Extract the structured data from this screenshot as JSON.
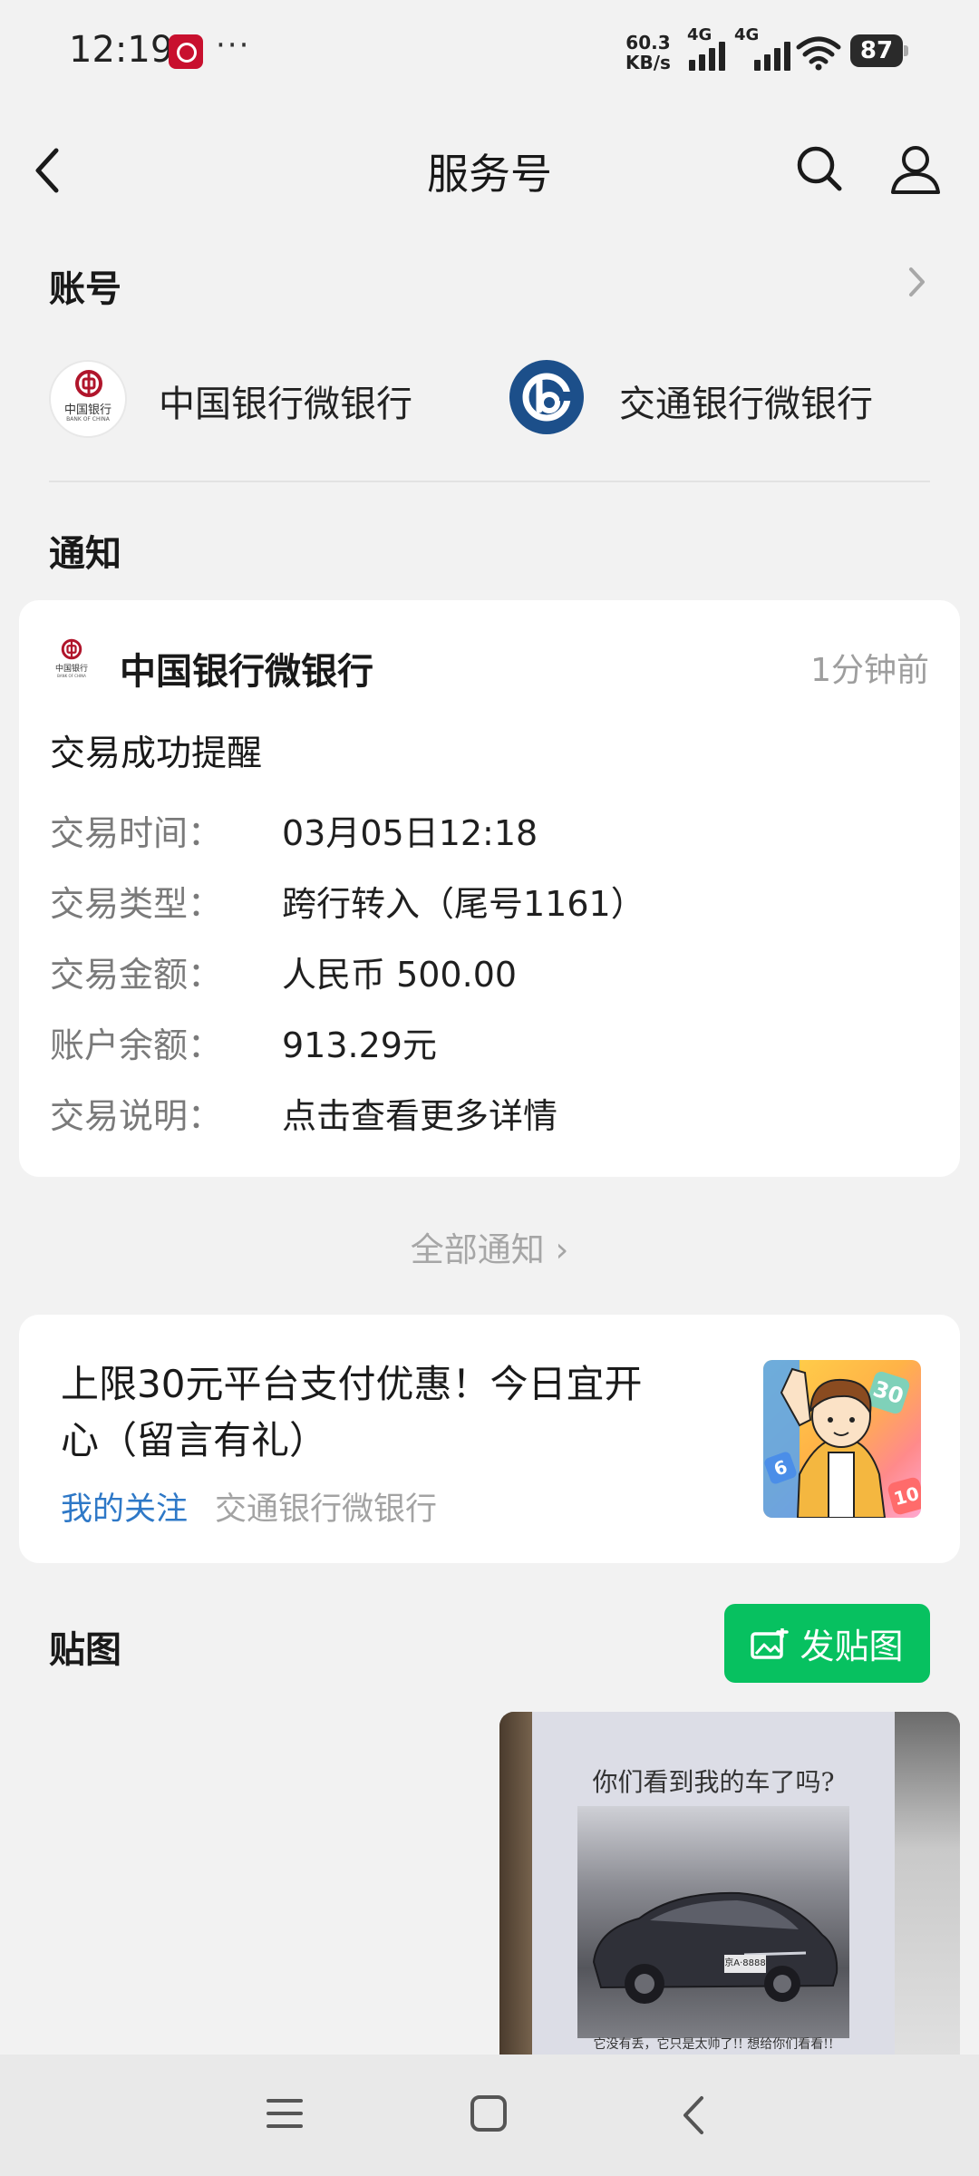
{
  "status_bar": {
    "time": "12:19",
    "more": "···",
    "net_speed_value": "60.3",
    "net_speed_unit": "KB/s",
    "network_1": "4G",
    "network_2": "4G",
    "battery": "87"
  },
  "nav": {
    "title": "服务号"
  },
  "accounts": {
    "title": "账号",
    "items": [
      {
        "name": "中国银行微银行",
        "logo_text": "中国银行",
        "logo_subtext": "BANK OF CHINA"
      },
      {
        "name": "交通银行微银行"
      }
    ]
  },
  "notifications": {
    "title": "通知",
    "card": {
      "sender": "中国银行微银行",
      "logo_text": "中国银行",
      "logo_subtext": "BANK OF CHINA",
      "time": "1分钟前",
      "heading": "交易成功提醒",
      "rows": [
        {
          "label": "交易时间：",
          "value": "03月05日12:18"
        },
        {
          "label": "交易类型：",
          "value": "跨行转入（尾号1161）"
        },
        {
          "label": "交易金额：",
          "value": "人民币 500.00"
        },
        {
          "label": "账户余额：",
          "value": "913.29元"
        },
        {
          "label": "交易说明：",
          "value": "点击查看更多详情"
        }
      ]
    },
    "all_link": "全部通知 ›"
  },
  "promo": {
    "title_line1": "上限30元平台支付优惠！今日宜开",
    "title_line2": "心（留言有礼）",
    "tag": "我的关注",
    "source": "交通银行微银行",
    "badge_1": "30",
    "badge_2": "10",
    "badge_3": "6"
  },
  "stickers": {
    "title": "贴图",
    "button": "发贴图",
    "post_caption": "你们看到我的车了吗?",
    "post_plate": "京A·8888",
    "post_bottom_text": "它没有丢，它只是太帅了!! 想给你们看看!!"
  },
  "colors": {
    "accent_green": "#07c160",
    "link_blue": "#2e78c7",
    "boc_red": "#b0152b",
    "bocom_blue": "#1c4f8a"
  }
}
